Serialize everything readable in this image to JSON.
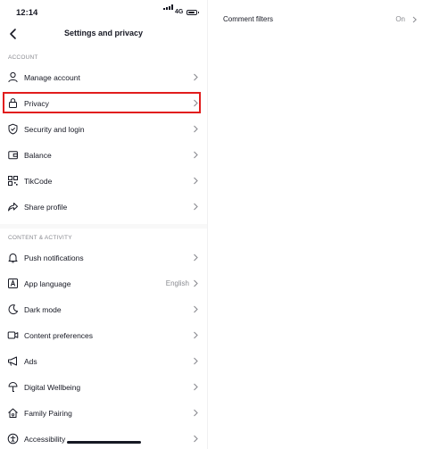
{
  "status": {
    "time": "12:14",
    "network": "4G"
  },
  "nav": {
    "title": "Settings and privacy"
  },
  "sections": {
    "account": "ACCOUNT",
    "content": "CONTENT & ACTIVITY"
  },
  "account_items": [
    {
      "label": "Manage account",
      "icon": "person-icon"
    },
    {
      "label": "Privacy",
      "icon": "lock-icon"
    },
    {
      "label": "Security and login",
      "icon": "shield-icon"
    },
    {
      "label": "Balance",
      "icon": "wallet-icon"
    },
    {
      "label": "TikCode",
      "icon": "qr-code-icon"
    },
    {
      "label": "Share profile",
      "icon": "share-icon"
    }
  ],
  "content_items": [
    {
      "label": "Push notifications",
      "icon": "bell-icon"
    },
    {
      "label": "App language",
      "icon": "language-icon",
      "value": "English"
    },
    {
      "label": "Dark mode",
      "icon": "moon-icon"
    },
    {
      "label": "Content preferences",
      "icon": "video-icon"
    },
    {
      "label": "Ads",
      "icon": "megaphone-icon"
    },
    {
      "label": "Digital Wellbeing",
      "icon": "wellbeing-icon"
    },
    {
      "label": "Family Pairing",
      "icon": "home-icon"
    },
    {
      "label": "Accessibility",
      "icon": "accessibility-icon"
    }
  ],
  "right_panel": {
    "label": "Comment filters",
    "value": "On"
  },
  "colors": {
    "highlight": "#e11d1d",
    "text": "#161823",
    "muted": "#8a8b91"
  }
}
